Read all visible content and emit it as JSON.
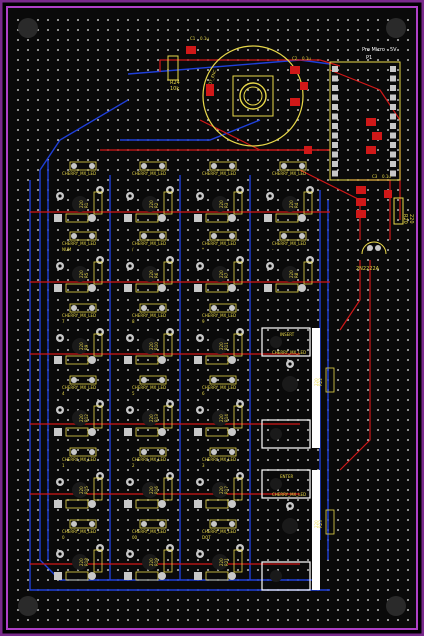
{
  "colors": {
    "board": "#0a0a0a",
    "outline": "#7a2a8c",
    "outline_inner": "#b040c8",
    "silk": "#e8d84a",
    "copper_top": "#d01818",
    "copper_bottom": "#1f3fd8",
    "pad": "#c8c8c8",
    "hole": "#000000",
    "pad_ring": "#d0a0d0"
  },
  "header": {
    "title": "Pro Micro - 5V",
    "ref": "P1"
  },
  "top_parts": {
    "r_main": "R24",
    "r_main_val": "10k",
    "encoder": "ROT_ENC",
    "transistor": "2N2222A",
    "r_side_ref": "R20",
    "r_side_val": "220"
  },
  "rows": [
    {
      "name": "row-0",
      "keys": [
        {
          "sw": "CHERRY_MX_LED",
          "label": "",
          "r": "R1",
          "v": "220",
          "d": "D1"
        },
        {
          "sw": "CHERRY_MX_LED",
          "label": "",
          "r": "R2",
          "v": "220",
          "d": "D2"
        },
        {
          "sw": "CHERRY_MX_LED",
          "label": "",
          "r": "R3",
          "v": "220",
          "d": "D3"
        },
        {
          "sw": "CHERRY_MX_LED",
          "label": "",
          "r": "R4",
          "v": "220",
          "d": "D4"
        }
      ]
    },
    {
      "name": "row-1",
      "keys": [
        {
          "sw": "CHERRY_MX_LED",
          "label": "NUM",
          "r": "R5",
          "v": "220",
          "d": "D5"
        },
        {
          "sw": "CHERRY_MX_LED",
          "label": "/",
          "r": "R6",
          "v": "220",
          "d": "D6"
        },
        {
          "sw": "CHERRY_MX_LED",
          "label": "*",
          "r": "R7",
          "v": "220",
          "d": "D7"
        },
        {
          "sw": "CHERRY_MX_LED",
          "label": "-",
          "r": "R8",
          "v": "220",
          "d": "D8"
        }
      ]
    },
    {
      "name": "row-2",
      "keys": [
        {
          "sw": "CHERRY_MX_LED",
          "label": "7",
          "r": "R9",
          "v": "220",
          "d": "D9"
        },
        {
          "sw": "CHERRY_MX_LED",
          "label": "8",
          "r": "R10",
          "v": "220",
          "d": "D10"
        },
        {
          "sw": "CHERRY_MX_LED",
          "label": "9",
          "r": "R11",
          "v": "220",
          "d": "D11"
        }
      ]
    },
    {
      "name": "row-3",
      "keys": [
        {
          "sw": "CHERRY_MX_LED",
          "label": "4",
          "r": "R12",
          "v": "220",
          "d": "D12"
        },
        {
          "sw": "CHERRY_MX_LED",
          "label": "5",
          "r": "R13",
          "v": "220",
          "d": "D13"
        },
        {
          "sw": "CHERRY_MX_LED",
          "label": "6",
          "r": "R14",
          "v": "220",
          "d": "D14"
        }
      ]
    },
    {
      "name": "row-4",
      "keys": [
        {
          "sw": "CHERRY_MX_LED",
          "label": "1",
          "r": "R15",
          "v": "220",
          "d": "D15"
        },
        {
          "sw": "CHERRY_MX_LED",
          "label": "2",
          "r": "R16",
          "v": "220",
          "d": "D16"
        },
        {
          "sw": "CHERRY_MX_LED",
          "label": "3",
          "r": "R17",
          "v": "220",
          "d": "D17"
        }
      ]
    },
    {
      "name": "row-5",
      "keys": [
        {
          "sw": "CHERRY_MX_LED",
          "label": "0",
          "r": "R18",
          "v": "220",
          "d": "D18"
        },
        {
          "sw": "CHERRY_MX_LED",
          "label": "00",
          "r": "R19",
          "v": "220",
          "d": "D19"
        },
        {
          "sw": "CHERRY_MX_LED",
          "label": "DOT",
          "r": "R21",
          "v": "220",
          "d": "D20"
        }
      ]
    }
  ],
  "tall_keys": [
    {
      "sw": "CHERRY_MX_LED",
      "label": "INSERT",
      "r": "R22",
      "v": "220"
    },
    {
      "sw": "CHERRY_MX_LED",
      "label": "ENTER",
      "r": "R23",
      "v": "220"
    }
  ],
  "caps": [
    "C1",
    "C2",
    "C3"
  ],
  "cap_val": "0.1u"
}
